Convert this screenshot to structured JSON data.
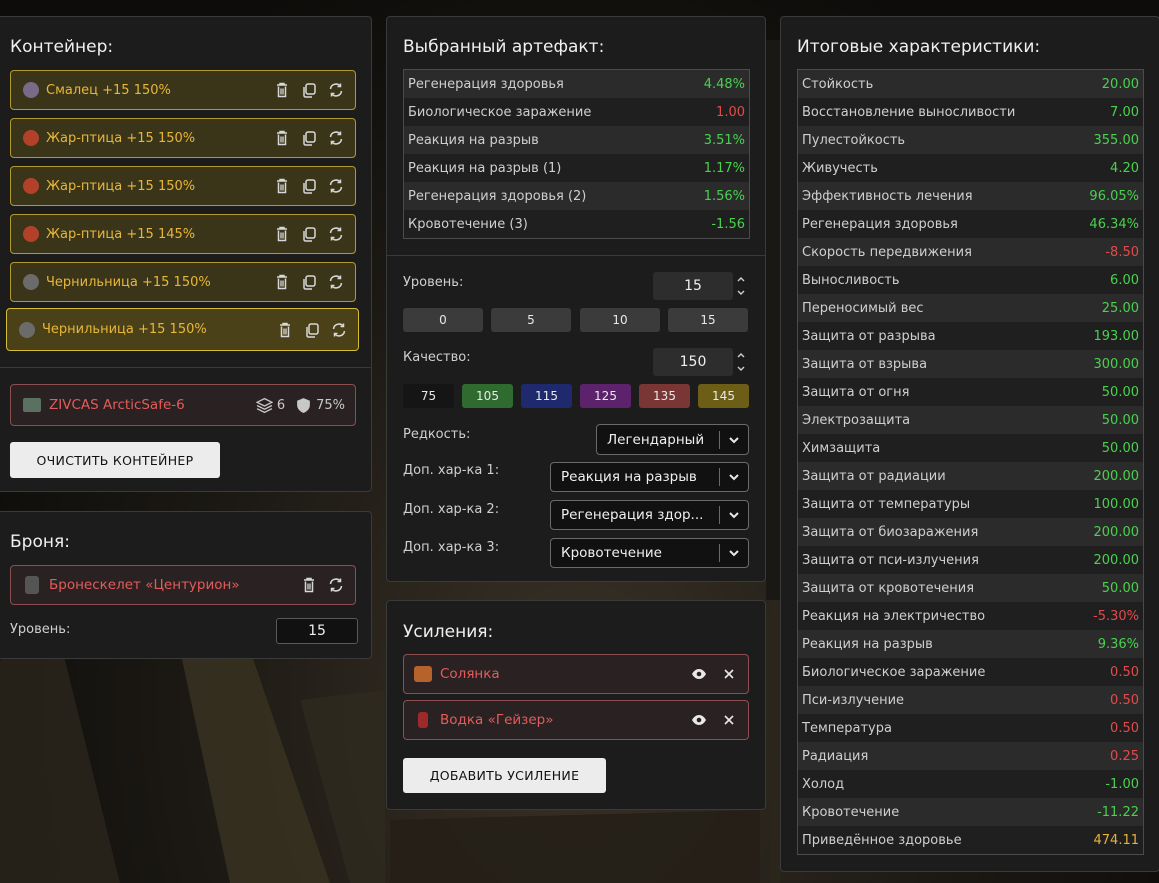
{
  "container": {
    "title": "Контейнер:",
    "slots": [
      {
        "name": "Смалец +15 150%",
        "icon": "smalets-artifact-icon"
      },
      {
        "name": "Жар-птица +15 150%",
        "icon": "zhar-ptitsa-artifact-icon"
      },
      {
        "name": "Жар-птица +15 150%",
        "icon": "zhar-ptitsa-artifact-icon"
      },
      {
        "name": "Жар-птица +15 145%",
        "icon": "zhar-ptitsa-artifact-icon"
      },
      {
        "name": "Чернильница +15 150%",
        "icon": "chernilnitsa-artifact-icon"
      },
      {
        "name": "Чернильница +15 150%",
        "icon": "chernilnitsa-artifact-icon"
      }
    ],
    "item": {
      "name": "ZIVCAS ArcticSafe-6",
      "capacity": "6",
      "protection": "75%"
    },
    "clear_button": "ОЧИСТИТЬ КОНТЕЙНЕР"
  },
  "armor": {
    "title": "Броня:",
    "item": "Бронескелет «Центурион»",
    "level_label": "Уровень:",
    "level": "15"
  },
  "artifact": {
    "title": "Выбранный артефакт:",
    "stats": [
      {
        "name": "Регенерация здоровья",
        "value": "4.48%",
        "tone": "pos"
      },
      {
        "name": "Биологическое заражение",
        "value": "1.00",
        "tone": "neg"
      },
      {
        "name": "Реакция на разрыв",
        "value": "3.51%",
        "tone": "pos"
      },
      {
        "name": "Реакция на разрыв (1)",
        "value": "1.17%",
        "tone": "pos"
      },
      {
        "name": "Регенерация здоровья (2)",
        "value": "1.56%",
        "tone": "pos"
      },
      {
        "name": "Кровотечение (3)",
        "value": "-1.56",
        "tone": "pos"
      }
    ],
    "level_label": "Уровень:",
    "level": "15",
    "level_presets": [
      "0",
      "5",
      "10",
      "15"
    ],
    "quality_label": "Качество:",
    "quality": "150",
    "quality_presets": [
      {
        "label": "75",
        "color": "#151515"
      },
      {
        "label": "105",
        "color": "#2f6b2f"
      },
      {
        "label": "115",
        "color": "#1f2a6e"
      },
      {
        "label": "125",
        "color": "#5c236c"
      },
      {
        "label": "135",
        "color": "#7a3535"
      },
      {
        "label": "145",
        "color": "#6d5e17"
      }
    ],
    "rarity_label": "Редкость:",
    "rarity": "Легендарный",
    "extra1_label": "Доп. хар-ка 1:",
    "extra1": "Реакция на разрыв",
    "extra2_label": "Доп. хар-ка 2:",
    "extra2": "Регенерация здор...",
    "extra3_label": "Доп. хар-ка 3:",
    "extra3": "Кровотечение"
  },
  "boosts": {
    "title": "Усиления:",
    "items": [
      {
        "name": "Солянка",
        "icon": "solyanka-icon",
        "color": "#b5632a"
      },
      {
        "name": "Водка «Гейзер»",
        "icon": "vodka-bottle-icon",
        "color": "#9c2a2a"
      }
    ],
    "add_button": "ДОБАВИТЬ УСИЛЕНИЕ"
  },
  "totals": {
    "title": "Итоговые характеристики:",
    "stats": [
      {
        "name": "Стойкость",
        "value": "20.00",
        "tone": "pos"
      },
      {
        "name": "Восстановление выносливости",
        "value": "7.00",
        "tone": "pos"
      },
      {
        "name": "Пулестойкость",
        "value": "355.00",
        "tone": "pos"
      },
      {
        "name": "Живучесть",
        "value": "4.20",
        "tone": "pos"
      },
      {
        "name": "Эффективность лечения",
        "value": "96.05%",
        "tone": "pos"
      },
      {
        "name": "Регенерация здоровья",
        "value": "46.34%",
        "tone": "pos"
      },
      {
        "name": "Скорость передвижения",
        "value": "-8.50",
        "tone": "neg"
      },
      {
        "name": "Выносливость",
        "value": "6.00",
        "tone": "pos"
      },
      {
        "name": "Переносимый вес",
        "value": "25.00",
        "tone": "pos"
      },
      {
        "name": "Защита от разрыва",
        "value": "193.00",
        "tone": "pos"
      },
      {
        "name": "Защита от взрыва",
        "value": "300.00",
        "tone": "pos"
      },
      {
        "name": "Защита от огня",
        "value": "50.00",
        "tone": "pos"
      },
      {
        "name": "Электрозащита",
        "value": "50.00",
        "tone": "pos"
      },
      {
        "name": "Химзащита",
        "value": "50.00",
        "tone": "pos"
      },
      {
        "name": "Защита от радиации",
        "value": "200.00",
        "tone": "pos"
      },
      {
        "name": "Защита от температуры",
        "value": "100.00",
        "tone": "pos"
      },
      {
        "name": "Защита от биозаражения",
        "value": "200.00",
        "tone": "pos"
      },
      {
        "name": "Защита от пси-излучения",
        "value": "200.00",
        "tone": "pos"
      },
      {
        "name": "Защита от кровотечения",
        "value": "50.00",
        "tone": "pos"
      },
      {
        "name": "Реакция на электричество",
        "value": "-5.30%",
        "tone": "neg"
      },
      {
        "name": "Реакция на разрыв",
        "value": "9.36%",
        "tone": "pos"
      },
      {
        "name": "Биологическое заражение",
        "value": "0.50",
        "tone": "neg"
      },
      {
        "name": "Пси-излучение",
        "value": "0.50",
        "tone": "neg"
      },
      {
        "name": "Температура",
        "value": "0.50",
        "tone": "neg"
      },
      {
        "name": "Радиация",
        "value": "0.25",
        "tone": "neg"
      },
      {
        "name": "Холод",
        "value": "-1.00",
        "tone": "pos"
      },
      {
        "name": "Кровотечение",
        "value": "-11.22",
        "tone": "pos"
      },
      {
        "name": "Приведённое здоровье",
        "value": "474.11",
        "tone": "gold"
      }
    ]
  }
}
